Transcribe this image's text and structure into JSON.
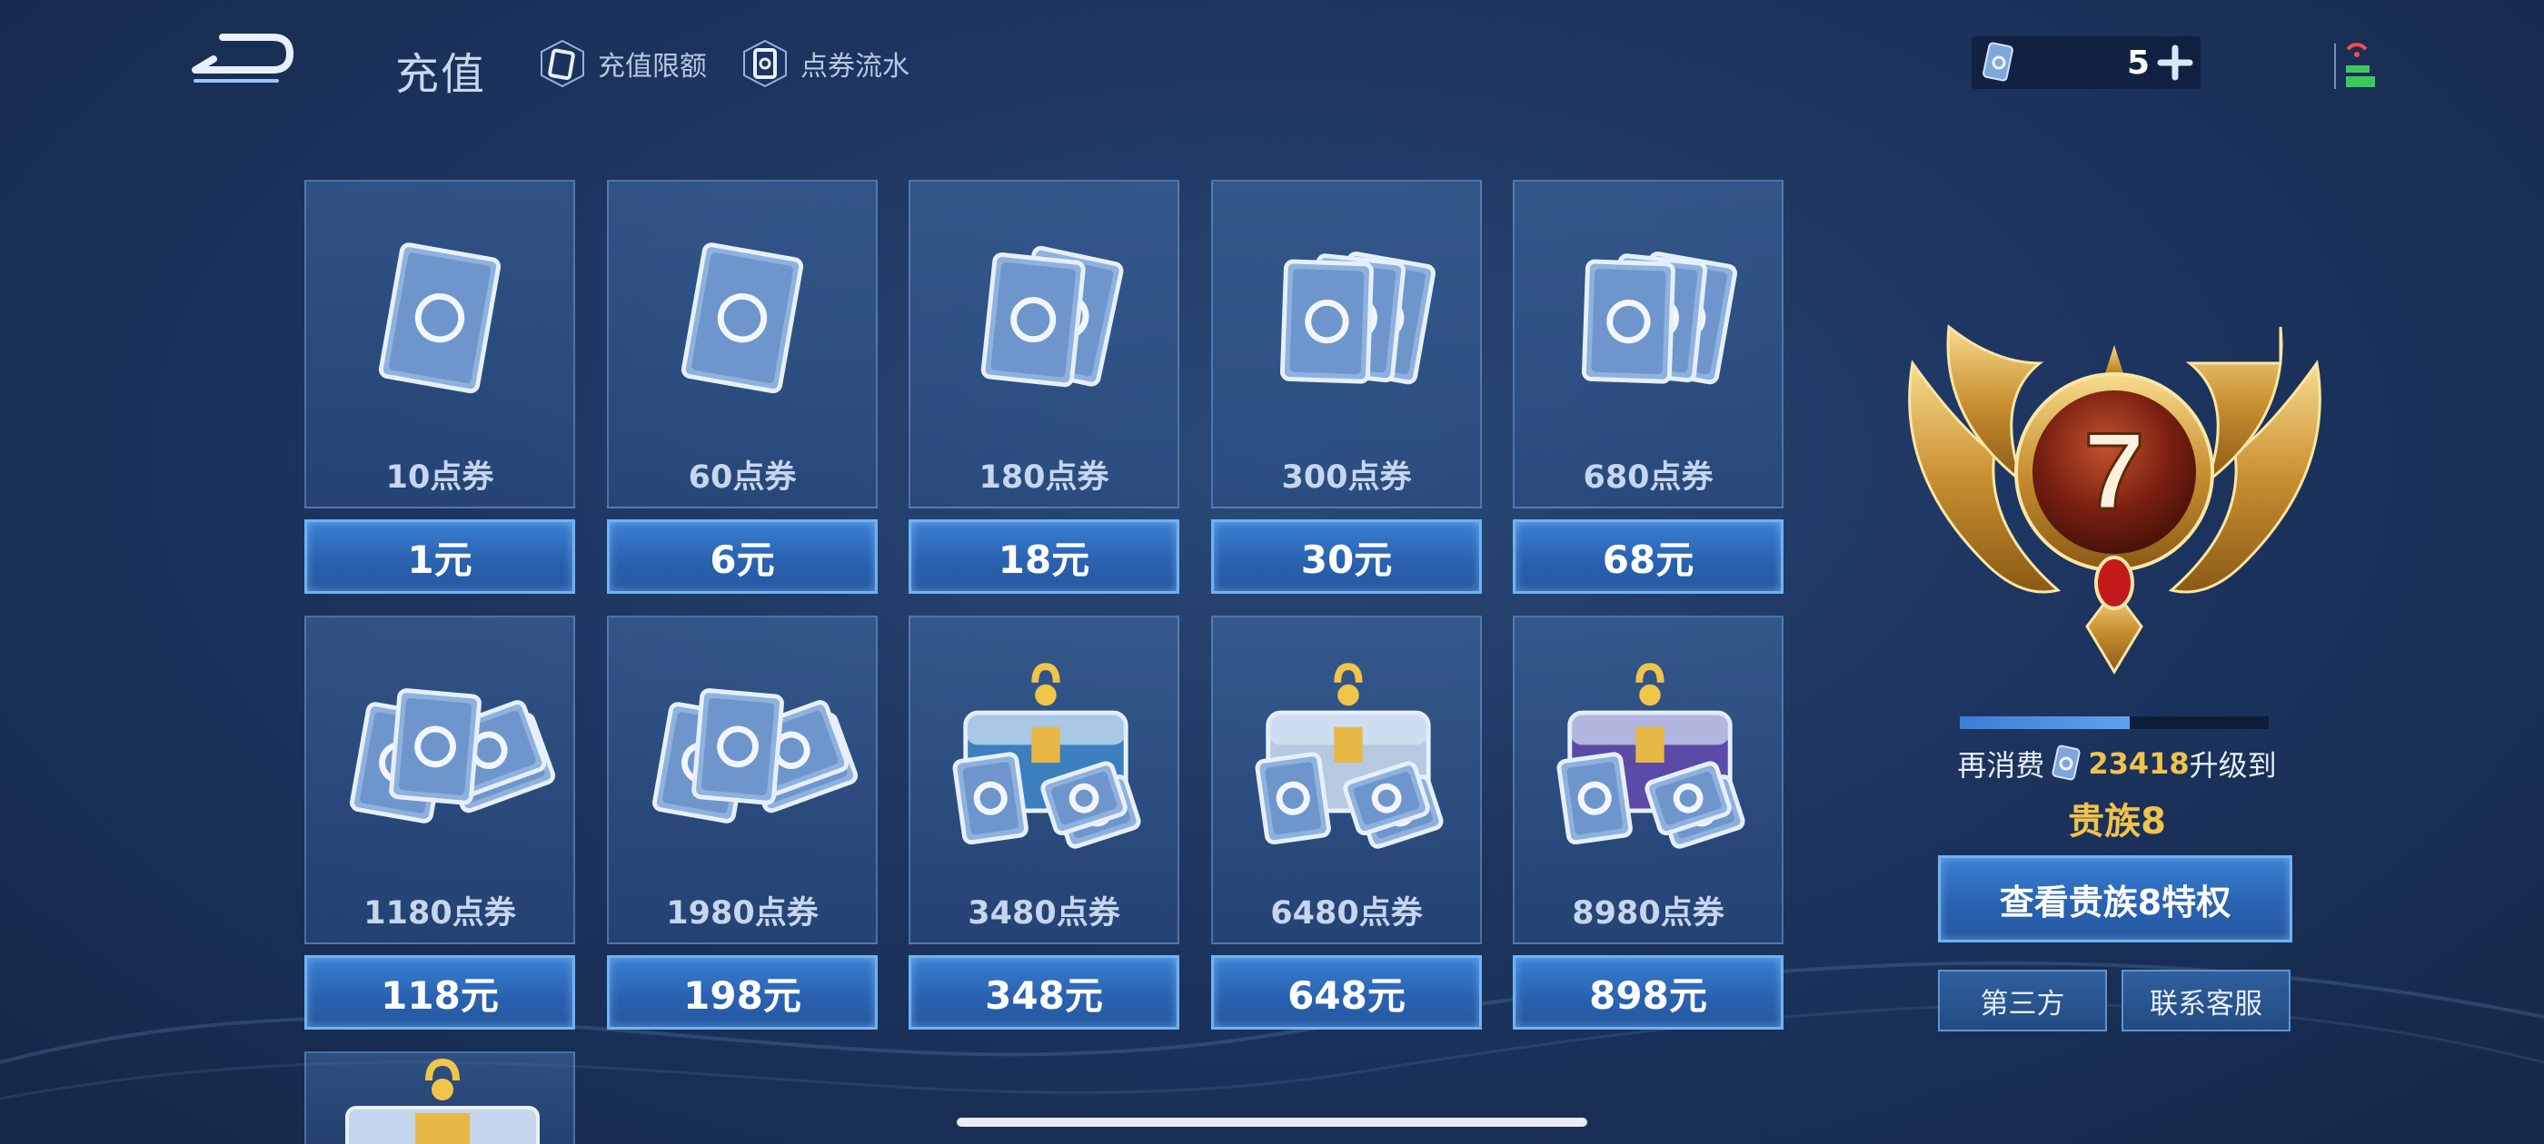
{
  "header": {
    "title": "充值",
    "links": [
      {
        "label": "充值限额",
        "icon": "coupon-card-icon"
      },
      {
        "label": "点券流水",
        "icon": "coupon-flow-icon"
      }
    ],
    "balance": "5"
  },
  "packages": [
    {
      "label": "10点券",
      "price": "1元",
      "art": "single-coupon"
    },
    {
      "label": "60点券",
      "price": "6元",
      "art": "single-coupon"
    },
    {
      "label": "180点券",
      "price": "18元",
      "art": "coupon-pair"
    },
    {
      "label": "300点券",
      "price": "30元",
      "art": "coupon-stack"
    },
    {
      "label": "680点券",
      "price": "68元",
      "art": "coupon-stack"
    },
    {
      "label": "1180点券",
      "price": "118元",
      "art": "coupon-pile"
    },
    {
      "label": "1980点券",
      "price": "198元",
      "art": "coupon-pile"
    },
    {
      "label": "3480点券",
      "price": "348元",
      "art": "chest-cyan"
    },
    {
      "label": "6480点券",
      "price": "648元",
      "art": "chest-silver"
    },
    {
      "label": "8980点券",
      "price": "898元",
      "art": "chest-purple"
    }
  ],
  "vip": {
    "level": "7",
    "progress": 0.55,
    "upgrade_prefix": "再消费",
    "upgrade_amount": "23418",
    "upgrade_suffix": "升级到",
    "next_level": "贵族8",
    "privilege_button": "查看贵族8特权",
    "third_party_button": "第三方",
    "support_button": "联系客服"
  },
  "colors": {
    "accent_gold": "#f1c24c",
    "button_blue": "#2a63b2",
    "button_border": "#6fb2f2"
  }
}
